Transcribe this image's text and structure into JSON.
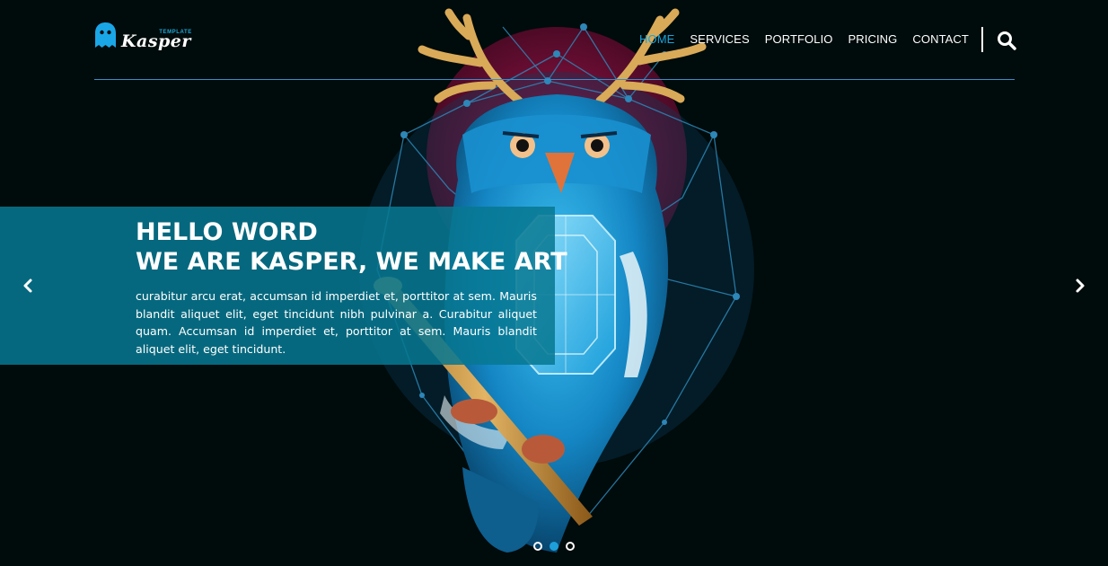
{
  "brand": {
    "name": "Kasper",
    "tag": "TEMPLATE"
  },
  "nav": {
    "items": [
      {
        "label": "HOME"
      },
      {
        "label": "SERVICES"
      },
      {
        "label": "PORTFOLIO"
      },
      {
        "label": "PRICING"
      },
      {
        "label": "CONTACT"
      }
    ],
    "active_index": 0
  },
  "hero": {
    "title_line1": "HELLO WORD",
    "title_line2": "WE ARE KASPER, WE MAKE ART",
    "text": "curabitur arcu erat, accumsan id imperdiet et, porttitor at sem. Mauris blandit aliquet elit, eget tincidunt nibh pulvinar a. Curabitur aliquet quam. Accumsan id imperdiet et, porttitor at sem. Mauris blandit aliquet elit, eget tincidunt."
  },
  "slider": {
    "slide_count": 3,
    "active_slide": 2
  },
  "icons": {
    "logo": "ghost-icon",
    "search": "search-icon",
    "prev": "chevron-left-icon",
    "next": "chevron-right-icon"
  },
  "colors": {
    "background": "#000b0b",
    "accent": "#19a4dc",
    "caption_bg": "#077891",
    "owl_blue": "#1aa6e6",
    "antler": "#d8a85a",
    "crimson": "#a0134a"
  }
}
